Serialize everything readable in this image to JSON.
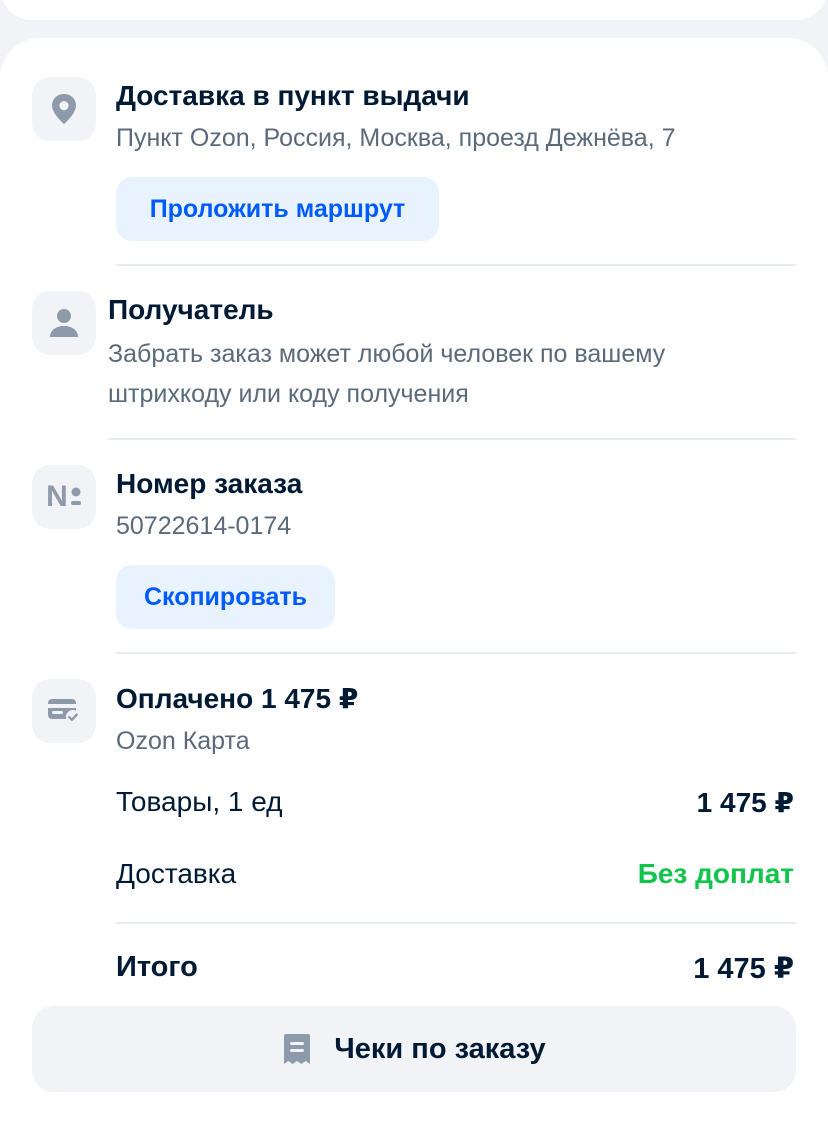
{
  "delivery": {
    "title": "Доставка в пункт выдачи",
    "address": "Пункт Ozon, Россия, Москва, проезд Дежнёва, 7",
    "route_button": "Проложить маршрут",
    "icon": "location-pin-icon"
  },
  "recipient": {
    "title": "Получатель",
    "description": "Забрать заказ может любой человек по вашему штрихкоду или коду получения",
    "icon": "person-icon"
  },
  "order": {
    "title": "Номер заказа",
    "number": "50722614-0174",
    "copy_button": "Скопировать",
    "icon": "numero-icon",
    "icon_text": "N"
  },
  "payment": {
    "title": "Оплачено 1 475 ₽",
    "method": "Ozon Карта",
    "icon": "card-check-icon"
  },
  "summary": {
    "goods_label": "Товары, 1 ед",
    "goods_value": "1 475 ₽",
    "delivery_label": "Доставка",
    "delivery_value": "Без доплат",
    "total_label": "Итого",
    "total_value": "1 475 ₽"
  },
  "receipts_button": "Чеки по заказу",
  "colors": {
    "accent": "#005bff",
    "accent_bg": "#e8f3ff",
    "success": "#10c44c",
    "text": "#001a34",
    "secondary": "#5b6a7a",
    "icon": "#8e9aab"
  }
}
